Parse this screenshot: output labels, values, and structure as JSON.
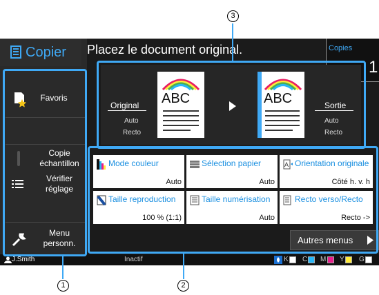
{
  "header": {
    "app_title": "Copier",
    "message": "Placez le document original.",
    "copies_label": "Copies",
    "copies_value": "1"
  },
  "sidebar": {
    "favorites_label": "Favoris",
    "sample_copy_label": "Copie échantillon",
    "check_settings_label": "Vérifier réglage",
    "custom_menu_label": "Menu personn."
  },
  "preview": {
    "original_label": "Original",
    "original_mode": "Auto",
    "original_side": "Recto",
    "output_label": "Sortie",
    "output_mode": "Auto",
    "output_side": "Recto",
    "doc_text": "ABC"
  },
  "settings": [
    {
      "title": "Mode couleur",
      "value": "Auto",
      "icon": "color-mode-icon"
    },
    {
      "title": "Sélection papier",
      "value": "Auto",
      "icon": "paper-tray-icon"
    },
    {
      "title": "Orientation originale",
      "value": "Côté h. v. h",
      "icon": "orientation-icon"
    },
    {
      "title": "Taille reproduction",
      "value": "100 % (1:1)",
      "icon": "reproduction-size-icon"
    },
    {
      "title": "Taille numérisation",
      "value": "Auto",
      "icon": "scan-size-icon"
    },
    {
      "title": "Recto verso/Recto",
      "value": "Recto ->",
      "icon": "duplex-icon"
    }
  ],
  "more_menus_label": "Autres menus",
  "status": {
    "user": "J.Smith",
    "state": "Inactif",
    "toner": [
      "K",
      "C",
      "M",
      "Y",
      "G"
    ],
    "toner_colors": [
      "#ffffff",
      "#29b6f6",
      "#e91e8c",
      "#ffeb3b",
      "#ffffff"
    ]
  },
  "callouts": {
    "one": "1",
    "two": "2",
    "three": "3"
  },
  "colors": {
    "accent": "#3fa9f5",
    "title_blue": "#1a8fe0"
  }
}
